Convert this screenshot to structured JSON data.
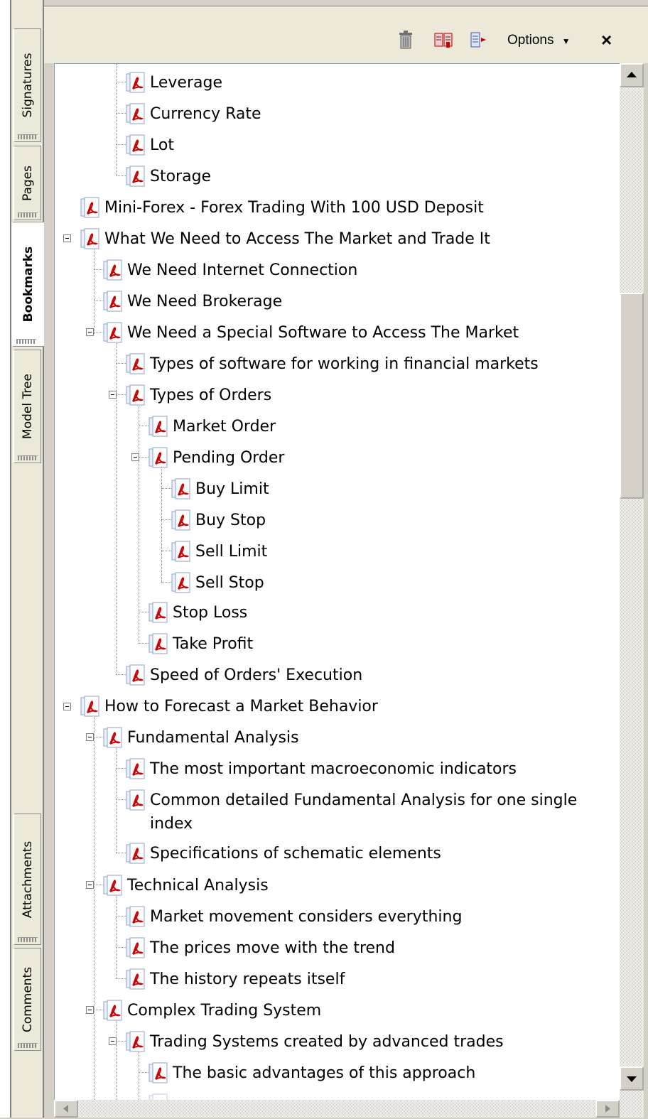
{
  "side_tabs": [
    {
      "label": "Signatures",
      "active": false
    },
    {
      "label": "Pages",
      "active": false
    },
    {
      "label": "Bookmarks",
      "active": true
    },
    {
      "label": "Model Tree",
      "active": false
    },
    {
      "label": "Attachments",
      "active": false
    },
    {
      "label": "Comments",
      "active": false
    }
  ],
  "toolbar": {
    "delete_icon": "trash-icon",
    "new_bookmark_icon": "new-bookmark-icon",
    "expand_icon": "expand-bookmark-icon",
    "options_label": "Options",
    "close_label": "×"
  },
  "bookmarks": [
    {
      "label": "Leverage",
      "level": 2
    },
    {
      "label": "Currency Rate",
      "level": 2
    },
    {
      "label": "Lot",
      "level": 2
    },
    {
      "label": "Storage",
      "level": 2
    },
    {
      "label": "Mini-Forex - Forex Trading With 100 USD Deposit",
      "level": 0
    },
    {
      "label": "What We Need to Access The Market and Trade It",
      "level": 0,
      "expanded": true
    },
    {
      "label": "We Need Internet Connection",
      "level": 1
    },
    {
      "label": "We Need Brokerage",
      "level": 1
    },
    {
      "label": "We Need a Special Software to Access The Market",
      "level": 1,
      "expanded": true
    },
    {
      "label": "Types of software for working in  financial markets",
      "level": 2
    },
    {
      "label": "Types of Orders",
      "level": 2,
      "expanded": true
    },
    {
      "label": "Market Order",
      "level": 3
    },
    {
      "label": "Pending Order",
      "level": 3,
      "expanded": true
    },
    {
      "label": "Buy Limit",
      "level": 4
    },
    {
      "label": "Buy Stop",
      "level": 4
    },
    {
      "label": "Sell Limit",
      "level": 4
    },
    {
      "label": "Sell Stop",
      "level": 4
    },
    {
      "label": "Stop Loss",
      "level": 3
    },
    {
      "label": "Take Profit",
      "level": 3
    },
    {
      "label": "Speed of Orders'  Execution",
      "level": 2
    },
    {
      "label": "How to Forecast a Market Behavior",
      "level": 0,
      "expanded": true
    },
    {
      "label": "Fundamental Analysis",
      "level": 1,
      "expanded": true
    },
    {
      "label": "The most important macroeconomic indicators",
      "level": 2
    },
    {
      "label": "Common detailed Fundamental Analysis for one single index",
      "level": 2
    },
    {
      "label": "Specifications of schematic elements",
      "level": 2
    },
    {
      "label": "Technical Analysis",
      "level": 1,
      "expanded": true
    },
    {
      "label": "Market movement considers everything",
      "level": 2
    },
    {
      "label": "The prices move with the trend",
      "level": 2
    },
    {
      "label": "The history repeats itself",
      "level": 2
    },
    {
      "label": "Complex Trading System",
      "level": 1,
      "expanded": true
    },
    {
      "label": "Trading Systems created by advanced trades",
      "level": 2,
      "expanded": true
    },
    {
      "label": "The basic advantages of this approach",
      "level": 3
    }
  ],
  "colors": {
    "pdf_red": "#cc0000",
    "panel_bg": "#ffffff",
    "chrome_bg": "#ece9d8"
  }
}
